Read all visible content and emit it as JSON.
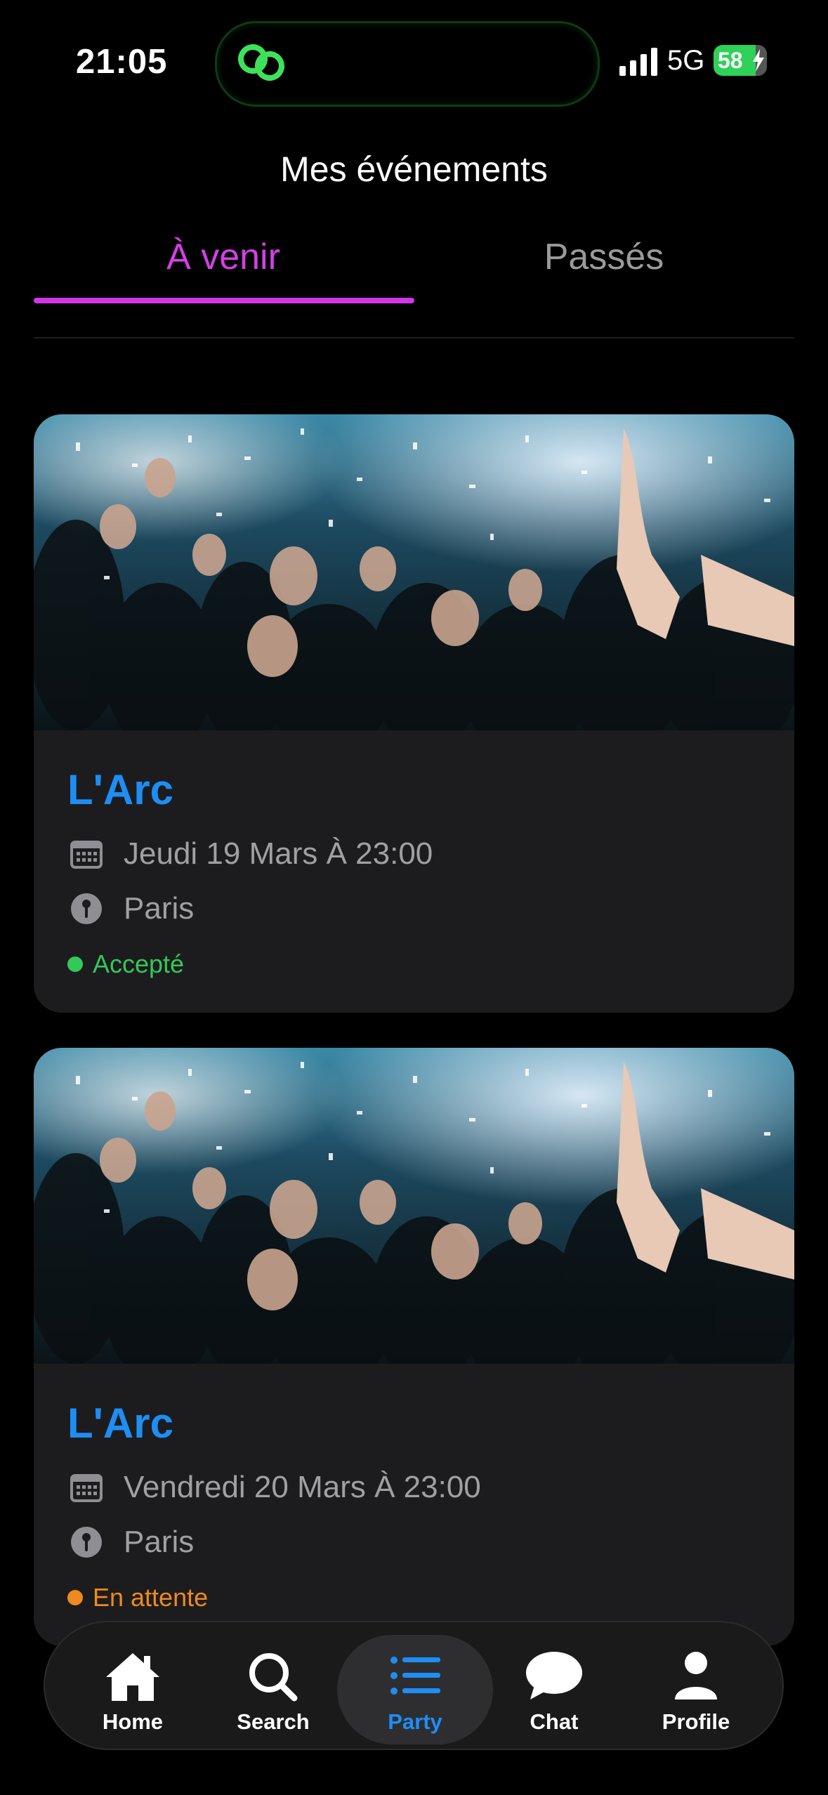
{
  "status_bar": {
    "time": "21:05",
    "network": "5G",
    "battery": "58",
    "icons": [
      "dynamic-island-link-icon",
      "signal-icon",
      "battery-icon",
      "charging-bolt-icon"
    ]
  },
  "header": {
    "title": "Mes événements"
  },
  "tabs": [
    {
      "label": "À venir",
      "active": true
    },
    {
      "label": "Passés",
      "active": false
    }
  ],
  "events": [
    {
      "title": "L'Arc",
      "date": "Jeudi 19 Mars À 23:00",
      "location": "Paris",
      "status": "Accepté",
      "status_color": "#34c759"
    },
    {
      "title": "L'Arc",
      "date": "Vendredi 20 Mars À 23:00",
      "location": "Paris",
      "status": "En attente",
      "status_color": "#ef8a1f"
    }
  ],
  "nav": [
    {
      "label": "Home",
      "icon": "home-icon",
      "active": false
    },
    {
      "label": "Search",
      "icon": "search-icon",
      "active": false
    },
    {
      "label": "Party",
      "icon": "list-icon",
      "active": true
    },
    {
      "label": "Chat",
      "icon": "chat-bubble-icon",
      "active": false
    },
    {
      "label": "Profile",
      "icon": "person-icon",
      "active": false
    }
  ],
  "colors": {
    "accent_tab": "#d43fe6",
    "title_blue": "#1e8ef5",
    "card_bg": "#1c1c1e"
  }
}
